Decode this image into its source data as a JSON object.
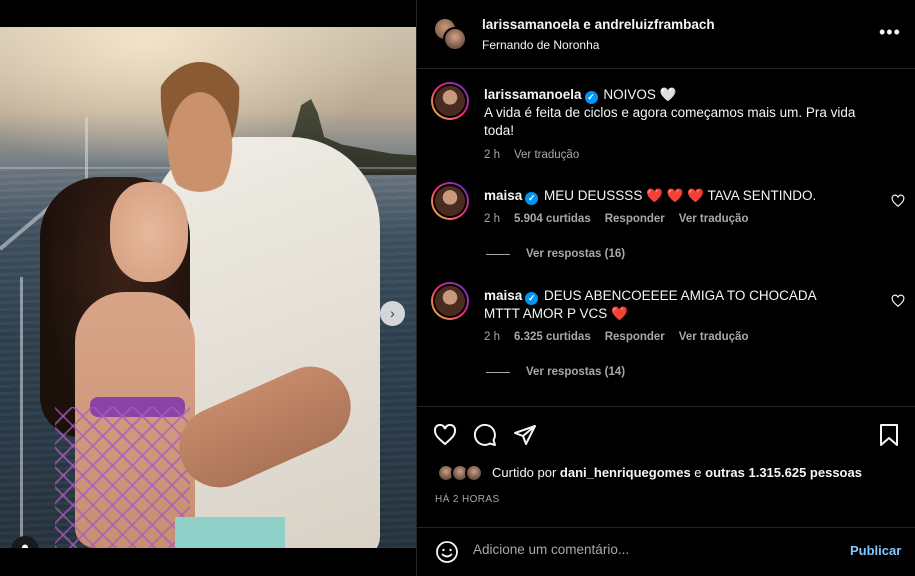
{
  "post": {
    "tag_icon": "user-tag-icon",
    "next_arrow": "›",
    "carousel_dots": 2
  },
  "header": {
    "names": "larissamanoela e andreluizframbach",
    "location": "Fernando de Noronha",
    "more": "•••"
  },
  "caption": {
    "username": "larissamanoela",
    "text_line1": "NOIVOS 🤍",
    "text_rest": "A vida é feita de ciclos e agora começamos mais um. Pra vida toda!",
    "time": "2 h",
    "translate": "Ver tradução"
  },
  "comments": [
    {
      "username": "maisa",
      "text": "MEU DEUSSSS ",
      "hearts": "❤️ ❤️ ❤️",
      "text_after": " TAVA SENTINDO.",
      "time": "2 h",
      "likes": "5.904 curtidas",
      "reply": "Responder",
      "translate": "Ver tradução",
      "view_replies": "Ver respostas (16)"
    },
    {
      "username": "maisa",
      "text": "DEUS ABENCOEEEE AMIGA TO CHOCADA MTTT AMOR P VCS ",
      "hearts": "❤️",
      "time": "2 h",
      "likes": "6.325 curtidas",
      "reply": "Responder",
      "translate": "Ver tradução",
      "view_replies": "Ver respostas (14)"
    }
  ],
  "actions": {
    "liked_by_prefix": "Curtido por ",
    "liked_by_user": "dani_henriquegomes",
    "liked_by_mid": " e ",
    "liked_by_others": "outras 1.315.625 pessoas",
    "time_ago": "HÁ 2 HORAS"
  },
  "comment_box": {
    "placeholder": "Adicione um comentário...",
    "publish": "Publicar"
  },
  "colors": {
    "background": "#000000",
    "verified": "#0095f6",
    "heart": "#ed4956",
    "publish": "#85c8ff",
    "muted": "#a8a8a8"
  }
}
